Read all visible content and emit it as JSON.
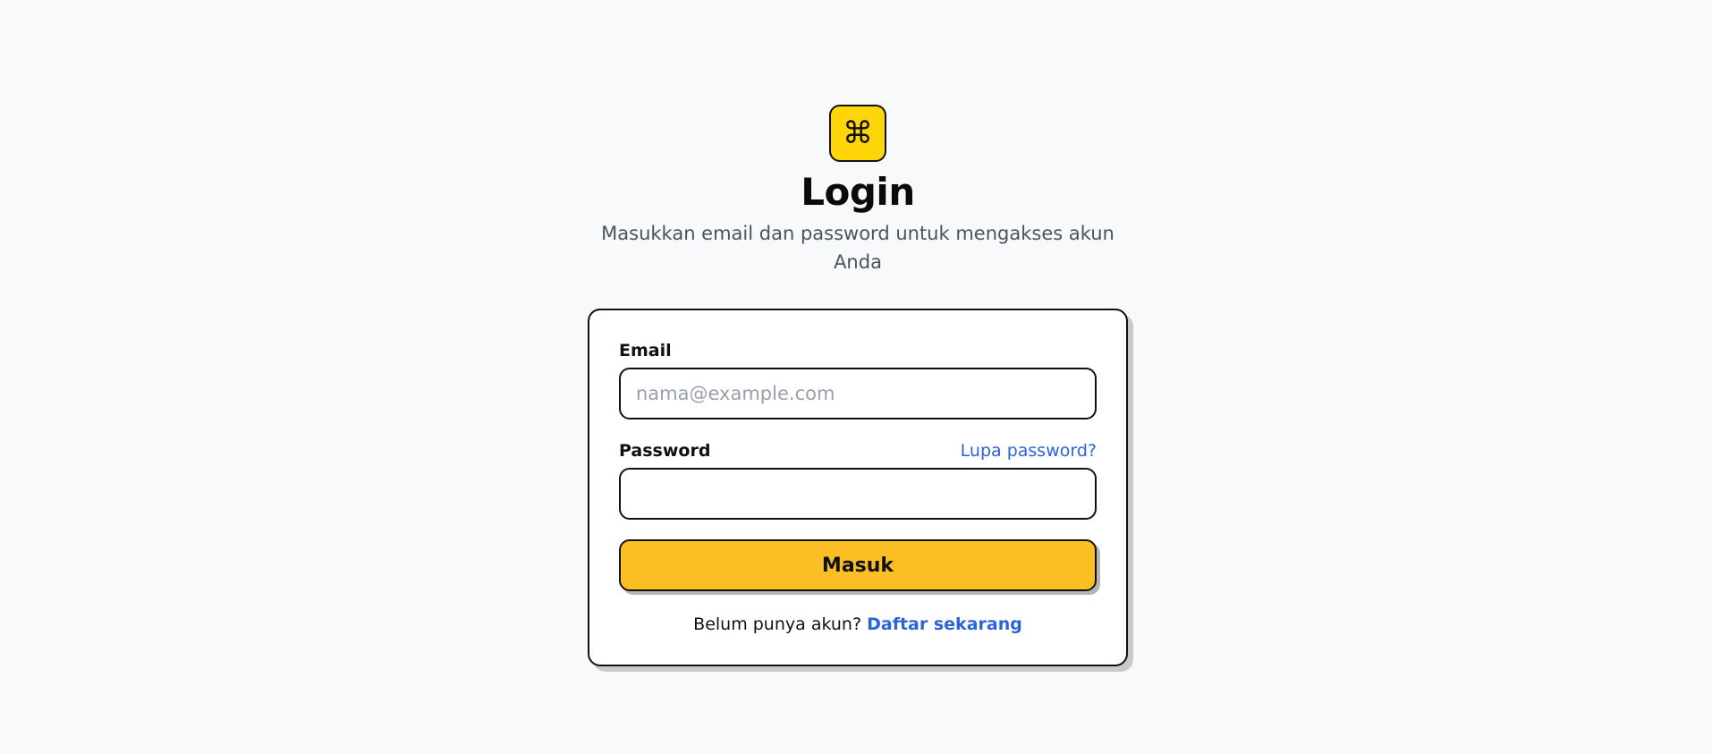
{
  "header": {
    "logo_glyph": "⌘",
    "logo_icon": "command-icon",
    "title": "Login",
    "subtitle": "Masukkan email dan password untuk mengakses akun Anda"
  },
  "form": {
    "email": {
      "label": "Email",
      "value": "",
      "placeholder": "nama@example.com"
    },
    "password": {
      "label": "Password",
      "value": "",
      "placeholder": "",
      "forgot_link": "Lupa password?"
    },
    "submit_label": "Masuk"
  },
  "footer": {
    "prompt": "Belum punya akun?",
    "register_link": "Daftar sekarang"
  },
  "colors": {
    "background": "#f8f9fb",
    "logo_bg": "#ffd60a",
    "button_bg": "#fbbf24",
    "link": "#2b63d9",
    "border": "#111111"
  }
}
